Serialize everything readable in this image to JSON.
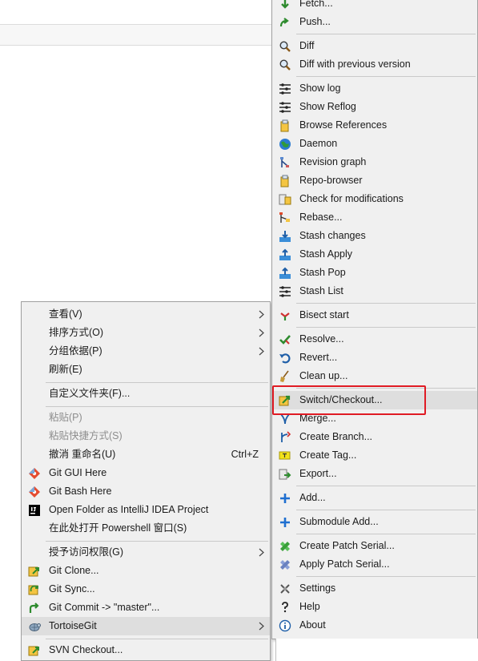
{
  "context_menu": {
    "items": [
      {
        "label": "查看(V)",
        "submenu": true
      },
      {
        "label": "排序方式(O)",
        "submenu": true
      },
      {
        "label": "分组依据(P)",
        "submenu": true
      },
      {
        "label": "刷新(E)"
      },
      {
        "label": "自定义文件夹(F)..."
      },
      {
        "label": "粘贴(P)",
        "disabled": true
      },
      {
        "label": "粘贴快捷方式(S)",
        "disabled": true
      },
      {
        "label": "撤消 重命名(U)",
        "shortcut": "Ctrl+Z"
      },
      {
        "label": "Git GUI Here",
        "icon": "git-gui-icon"
      },
      {
        "label": "Git Bash Here",
        "icon": "git-bash-icon"
      },
      {
        "label": "Open Folder as IntelliJ IDEA Project",
        "icon": "intellij-icon"
      },
      {
        "label": "在此处打开 Powershell 窗口(S)"
      },
      {
        "label": "授予访问权限(G)",
        "submenu": true
      },
      {
        "label": "Git Clone...",
        "icon": "git-clone-icon"
      },
      {
        "label": "Git Sync...",
        "icon": "git-sync-icon"
      },
      {
        "label": "Git Commit -> \"master\"...",
        "icon": "git-commit-icon"
      },
      {
        "label": "TortoiseGit",
        "icon": "tortoisegit-icon",
        "submenu": true,
        "highlighted": true
      },
      {
        "label": "SVN Checkout...",
        "icon": "svn-checkout-icon"
      }
    ]
  },
  "git_menu": {
    "items": [
      {
        "label": "Fetch...",
        "icon": "fetch-icon"
      },
      {
        "label": "Push...",
        "icon": "push-icon"
      },
      {
        "label": "Diff",
        "icon": "diff-icon"
      },
      {
        "label": "Diff with previous version",
        "icon": "diff-previous-icon"
      },
      {
        "label": "Show log",
        "icon": "log-icon"
      },
      {
        "label": "Show Reflog",
        "icon": "reflog-icon"
      },
      {
        "label": "Browse References",
        "icon": "references-icon"
      },
      {
        "label": "Daemon",
        "icon": "daemon-icon"
      },
      {
        "label": "Revision graph",
        "icon": "revision-graph-icon"
      },
      {
        "label": "Repo-browser",
        "icon": "repo-browser-icon"
      },
      {
        "label": "Check for modifications",
        "icon": "check-modifications-icon"
      },
      {
        "label": "Rebase...",
        "icon": "rebase-icon"
      },
      {
        "label": "Stash changes",
        "icon": "stash-changes-icon"
      },
      {
        "label": "Stash Apply",
        "icon": "stash-apply-icon"
      },
      {
        "label": "Stash Pop",
        "icon": "stash-pop-icon"
      },
      {
        "label": "Stash List",
        "icon": "stash-list-icon"
      },
      {
        "label": "Bisect start",
        "icon": "bisect-icon"
      },
      {
        "label": "Resolve...",
        "icon": "resolve-icon"
      },
      {
        "label": "Revert...",
        "icon": "revert-icon"
      },
      {
        "label": "Clean up...",
        "icon": "cleanup-icon"
      },
      {
        "label": "Switch/Checkout...",
        "icon": "switch-checkout-icon",
        "highlighted": true
      },
      {
        "label": "Merge...",
        "icon": "merge-icon"
      },
      {
        "label": "Create Branch...",
        "icon": "create-branch-icon"
      },
      {
        "label": "Create Tag...",
        "icon": "create-tag-icon"
      },
      {
        "label": "Export...",
        "icon": "export-icon"
      },
      {
        "label": "Add...",
        "icon": "add-icon"
      },
      {
        "label": "Submodule Add...",
        "icon": "submodule-add-icon"
      },
      {
        "label": "Create Patch Serial...",
        "icon": "create-patch-icon"
      },
      {
        "label": "Apply Patch Serial...",
        "icon": "apply-patch-icon"
      },
      {
        "label": "Settings",
        "icon": "settings-icon"
      },
      {
        "label": "Help",
        "icon": "help-icon"
      },
      {
        "label": "About",
        "icon": "about-icon"
      }
    ]
  },
  "colors": {
    "menu_bg": "#f0f0f0",
    "highlight_bg": "#dedede",
    "annotation_red": "#e01b24"
  }
}
